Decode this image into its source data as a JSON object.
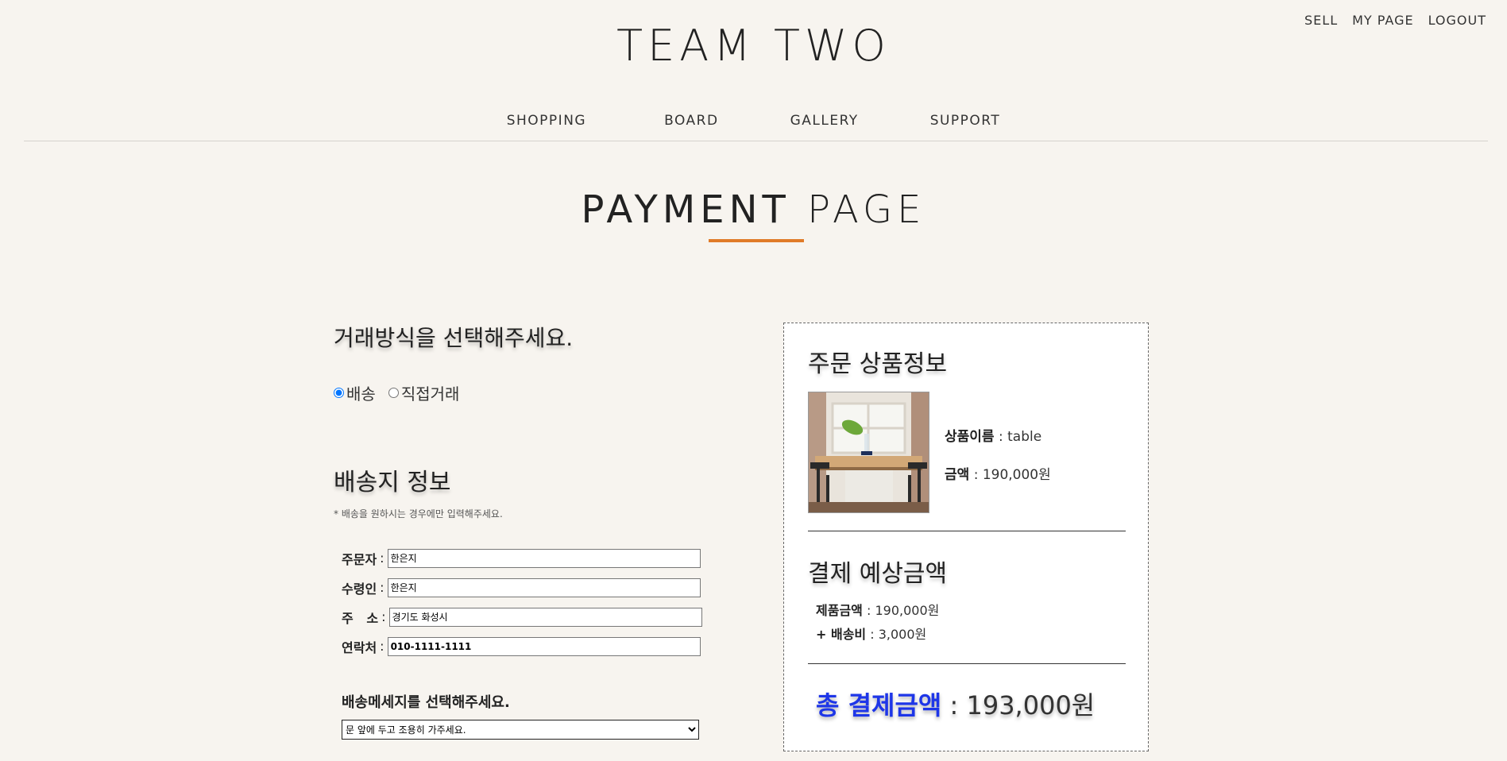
{
  "header": {
    "brand": "TEAM TWO",
    "top_links": [
      "SELL",
      "MY PAGE",
      "LOGOUT"
    ],
    "nav": [
      "SHOPPING",
      "BOARD",
      "GALLERY",
      "SUPPORT"
    ]
  },
  "page_title": {
    "bold": "PAYMENT",
    "light": "PAGE"
  },
  "method": {
    "heading": "거래방식을 선택해주세요.",
    "options": [
      "배송",
      "직접거래"
    ],
    "selected": "배송"
  },
  "shipping": {
    "heading": "배송지 정보",
    "note": "* 배송을 원하시는 경우에만 입력해주세요.",
    "fields": [
      {
        "label": "주문자",
        "value": "한은지"
      },
      {
        "label": "수령인",
        "value": "한은지"
      },
      {
        "label": "주   소",
        "value": "경기도 화성시"
      },
      {
        "label": "연락처",
        "value": "010-1111-1111"
      }
    ],
    "message_heading": "배송메세지를 선택해주세요.",
    "message_selected": "문 앞에 두고 조용히 가주세요."
  },
  "order": {
    "heading": "주문 상품정보",
    "product_name_label": "상품이름",
    "product_name": "table",
    "price_label": "금액",
    "price": "190,000원",
    "estimate_heading": "결제 예상금액",
    "product_amount_label": "제품금액",
    "product_amount": "190,000원",
    "shipping_label": "+ 배송비",
    "shipping_fee": "3,000원",
    "total_label": "총 결제금액",
    "total_value": "193,000원"
  },
  "colors": {
    "background": "#f7f4ef",
    "accent_underline": "#e07b28",
    "total_label": "#1e36e8"
  }
}
